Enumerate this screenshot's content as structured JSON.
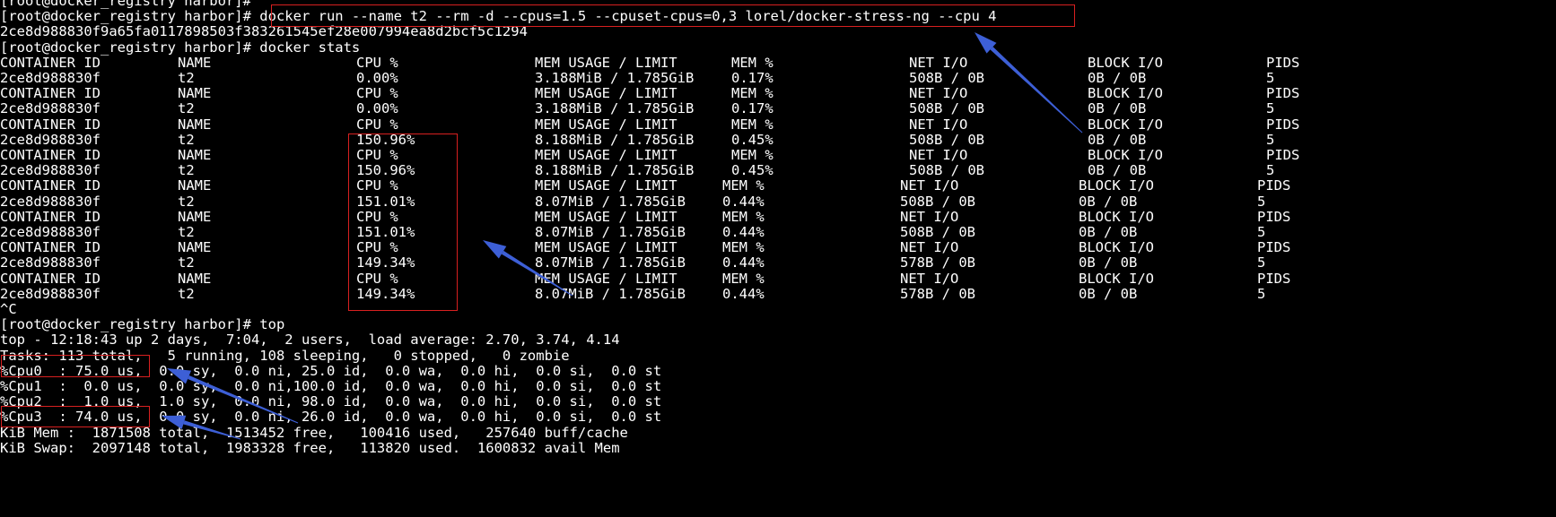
{
  "terminal": {
    "lines": [
      "[root@docker_registry harbor]#",
      "[root@docker_registry harbor]# docker run --name t2 --rm -d --cpus=1.5 --cpuset-cpus=0,3 lorel/docker-stress-ng --cpu 4",
      "2ce8d988830f9a65fa0117898503f383261545ef28e007994ea8d2bcf5c1294",
      "[root@docker_registry harbor]# docker stats"
    ],
    "stats_blocks": [
      {
        "header": [
          "CONTAINER ID",
          "NAME",
          "CPU %",
          "MEM USAGE / LIMIT",
          "MEM %",
          "NET I/O",
          "BLOCK I/O",
          "PIDS"
        ],
        "row": [
          "2ce8d988830f",
          "t2",
          "0.00%",
          "3.188MiB / 1.785GiB",
          "0.17%",
          "508B / 0B",
          "0B / 0B",
          "5"
        ]
      },
      {
        "header": [
          "CONTAINER ID",
          "NAME",
          "CPU %",
          "MEM USAGE / LIMIT",
          "MEM %",
          "NET I/O",
          "BLOCK I/O",
          "PIDS"
        ],
        "row": [
          "2ce8d988830f",
          "t2",
          "0.00%",
          "3.188MiB / 1.785GiB",
          "0.17%",
          "508B / 0B",
          "0B / 0B",
          "5"
        ]
      },
      {
        "header": [
          "CONTAINER ID",
          "NAME",
          "CPU %",
          "MEM USAGE / LIMIT",
          "MEM %",
          "NET I/O",
          "BLOCK I/O",
          "PIDS"
        ],
        "row": [
          "2ce8d988830f",
          "t2",
          "150.96%",
          "8.188MiB / 1.785GiB",
          "0.45%",
          "508B / 0B",
          "0B / 0B",
          "5"
        ]
      },
      {
        "header": [
          "CONTAINER ID",
          "NAME",
          "CPU %",
          "MEM USAGE / LIMIT",
          "MEM %",
          "NET I/O",
          "BLOCK I/O",
          "PIDS"
        ],
        "row": [
          "2ce8d988830f",
          "t2",
          "150.96%",
          "8.188MiB / 1.785GiB",
          "0.45%",
          "508B / 0B",
          "0B / 0B",
          "5"
        ]
      },
      {
        "header": [
          "CONTAINER ID",
          "NAME",
          "CPU %",
          "MEM USAGE / LIMIT",
          "MEM %",
          "NET I/O",
          "BLOCK I/O",
          "PIDS"
        ],
        "row": [
          "2ce8d988830f",
          "t2",
          "151.01%",
          "8.07MiB / 1.785GiB",
          "0.44%",
          "508B / 0B",
          "0B / 0B",
          "5"
        ]
      },
      {
        "header": [
          "CONTAINER ID",
          "NAME",
          "CPU %",
          "MEM USAGE / LIMIT",
          "MEM %",
          "NET I/O",
          "BLOCK I/O",
          "PIDS"
        ],
        "row": [
          "2ce8d988830f",
          "t2",
          "151.01%",
          "8.07MiB / 1.785GiB",
          "0.44%",
          "508B / 0B",
          "0B / 0B",
          "5"
        ]
      },
      {
        "header": [
          "CONTAINER ID",
          "NAME",
          "CPU %",
          "MEM USAGE / LIMIT",
          "MEM %",
          "NET I/O",
          "BLOCK I/O",
          "PIDS"
        ],
        "row": [
          "2ce8d988830f",
          "t2",
          "149.34%",
          "8.07MiB / 1.785GiB",
          "0.44%",
          "578B / 0B",
          "0B / 0B",
          "5"
        ]
      },
      {
        "header": [
          "CONTAINER ID",
          "NAME",
          "CPU %",
          "MEM USAGE / LIMIT",
          "MEM %",
          "NET I/O",
          "BLOCK I/O",
          "PIDS"
        ],
        "row": [
          "2ce8d988830f",
          "t2",
          "149.34%",
          "8.07MiB / 1.785GiB",
          "0.44%",
          "578B / 0B",
          "0B / 0B",
          "5"
        ]
      }
    ],
    "after_lines": [
      "^C",
      "[root@docker_registry harbor]# top",
      "top - 12:18:43 up 2 days,  7:04,  2 users,  load average: 2.70, 3.74, 4.14",
      "Tasks: 113 total,   5 running, 108 sleeping,   0 stopped,   0 zombie",
      "%Cpu0  : 75.0 us,  0.0 sy,  0.0 ni, 25.0 id,  0.0 wa,  0.0 hi,  0.0 si,  0.0 st",
      "%Cpu1  :  0.0 us,  0.0 sy,  0.0 ni,100.0 id,  0.0 wa,  0.0 hi,  0.0 si,  0.0 st",
      "%Cpu2  :  1.0 us,  1.0 sy,  0.0 ni, 98.0 id,  0.0 wa,  0.0 hi,  0.0 si,  0.0 st",
      "%Cpu3  : 74.0 us,  0.0 sy,  0.0 ni, 26.0 id,  0.0 wa,  0.0 hi,  0.0 si,  0.0 st",
      "KiB Mem :  1871508 total,  1513452 free,   100416 used,   257640 buff/cache",
      "KiB Swap:  2097148 total,  1983328 free,   113820 used.  1600832 avail Mem"
    ]
  },
  "colors": {
    "background": "#000000",
    "text": "#ffffff",
    "highlight_box": "#d82020",
    "arrow": "#3d5fd6"
  }
}
